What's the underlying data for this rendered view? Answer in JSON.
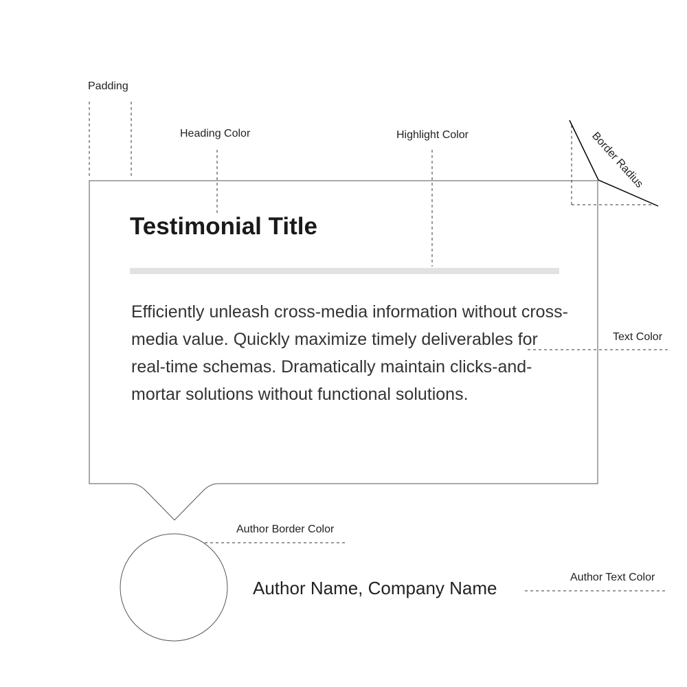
{
  "card": {
    "title": "Testimonial Title",
    "body": "Efficiently unleash cross-media information without cross-media value. Quickly maximize timely deliverables for real-time schemas. Dramatically maintain clicks-and-mortar solutions without functional solutions."
  },
  "author": {
    "name": "Author Name, Company Name"
  },
  "callouts": {
    "padding": "Padding",
    "heading_color": "Heading Color",
    "highlight_color": "Highlight Color",
    "border_radius": "Border Radius",
    "text_color": "Text Color",
    "author_border_color": "Author Border Color",
    "author_text_color": "Author Text Color"
  },
  "colors": {
    "outline": "#555555",
    "highlight_bar": "#e2e2e2",
    "heading": "#1a1a1a",
    "body_text": "#333333"
  }
}
